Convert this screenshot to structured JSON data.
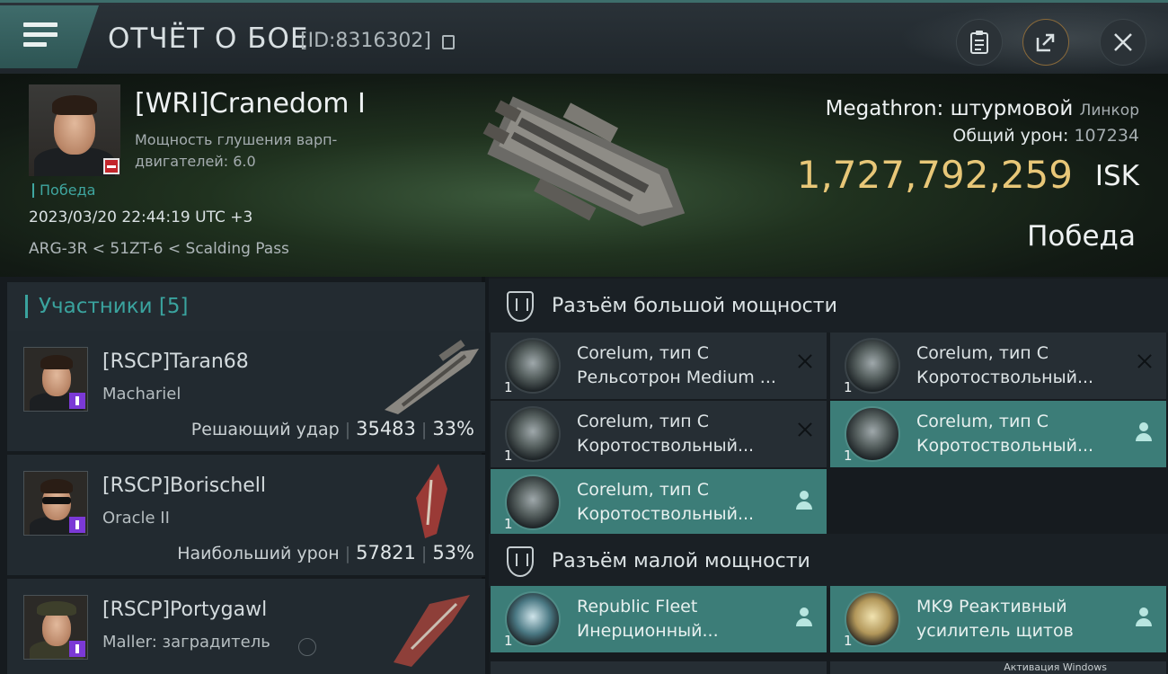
{
  "header": {
    "title": "ОТЧЁТ О БОЕ",
    "report_id": "[ID:8316302]"
  },
  "victim": {
    "name": "[WRI]Cranedom I",
    "jam_strength_label": "Мощность глушения варп-двигателей: 6.0",
    "result_tag": "Победа",
    "datetime": "2023/03/20 22:44:19 UTC +3",
    "location": "ARG-3R < 51ZT-6 < Scalding Pass",
    "ship": "Megathron: штурмовой",
    "ship_class": "Линкор",
    "total_damage_label": "Общий урон:",
    "total_damage": "107234",
    "value": "1,727,792,259",
    "currency": "ISK",
    "outcome": "Победа"
  },
  "participants": {
    "header": "Участники [5]",
    "items": [
      {
        "name": "[RSCP]Taran68",
        "ship": "Machariel",
        "role": "Решающий удар",
        "damage": "35483",
        "percent": "33%"
      },
      {
        "name": "[RSCP]Borischell",
        "ship": "Oracle II",
        "role": "Наибольший урон",
        "damage": "57821",
        "percent": "53%"
      },
      {
        "name": "[RSCP]Portygawl",
        "ship": "Maller: заградитель",
        "role": "",
        "damage": "",
        "percent": ""
      }
    ]
  },
  "fitting": {
    "high_slots_label": "Разъём большой мощности",
    "low_slots_label": "Разъём малой мощности",
    "high": [
      {
        "qty": "1",
        "line1": "Corelum, тип C",
        "line2": "Рельсотрон Medium ...",
        "state": "destroyed"
      },
      {
        "qty": "1",
        "line1": "Corelum, тип C",
        "line2": "Коротоствольный...",
        "state": "destroyed"
      },
      {
        "qty": "1",
        "line1": "Corelum, тип C",
        "line2": "Коротоствольный...",
        "state": "destroyed"
      },
      {
        "qty": "1",
        "line1": "Corelum, тип C",
        "line2": "Коротоствольный...",
        "state": "dropped"
      },
      {
        "qty": "1",
        "line1": "Corelum, тип C",
        "line2": "Коротоствольный...",
        "state": "dropped"
      }
    ],
    "low": [
      {
        "qty": "1",
        "line1": "Republic Fleet",
        "line2": "Инерционный...",
        "state": "dropped"
      },
      {
        "qty": "1",
        "line1": "MK9 Реактивный",
        "line2": "усилитель щитов",
        "state": "dropped"
      }
    ]
  },
  "system": {
    "watermark": "Активация Windows"
  },
  "icons": {
    "menu": "hamburger-icon",
    "copy": "copy-icon",
    "clipboard": "clipboard-icon",
    "share": "share-icon",
    "close": "close-icon",
    "slot": "shield-slot-icon"
  },
  "colors": {
    "accent_teal": "#3c7d78",
    "isk_gold": "#e8c778",
    "corp_badge_red": "#c3262c",
    "role_badge_purple": "#7b39d6"
  }
}
